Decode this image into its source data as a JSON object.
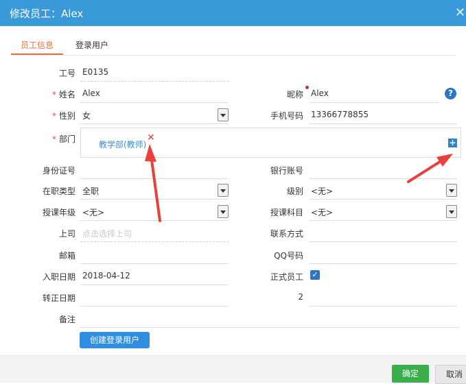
{
  "dialog": {
    "title": "修改员工：Alex"
  },
  "tabs": [
    {
      "label": "员工信息"
    },
    {
      "label": "登录用户"
    }
  ],
  "form": {
    "emp_no": {
      "label": "工号",
      "value": "E0135"
    },
    "name": {
      "label": "姓名",
      "value": "Alex"
    },
    "nickname": {
      "label": "昵称",
      "value": "Alex"
    },
    "gender": {
      "label": "性别",
      "value": "女"
    },
    "mobile": {
      "label": "手机号码",
      "value": "13366778855"
    },
    "dept": {
      "label": "部门",
      "tag": "教学部(教师)"
    },
    "idcard": {
      "label": "身份证号",
      "value": ""
    },
    "bank": {
      "label": "银行账号",
      "value": ""
    },
    "jobtype": {
      "label": "在职类型",
      "value": "全职"
    },
    "level": {
      "label": "级别",
      "value": "<无>"
    },
    "grade": {
      "label": "授课年级",
      "value": "<无>"
    },
    "subject": {
      "label": "授课科目",
      "value": "<无>"
    },
    "boss": {
      "label": "上司",
      "placeholder": "点击选择上司"
    },
    "contact": {
      "label": "联系方式",
      "value": ""
    },
    "email": {
      "label": "邮箱",
      "value": ""
    },
    "qq": {
      "label": "QQ号码",
      "value": ""
    },
    "hire_date": {
      "label": "入职日期",
      "value": "2018-04-12"
    },
    "formal": {
      "label": "正式员工",
      "checked": true
    },
    "regular_date": {
      "label": "转正日期",
      "value": ""
    },
    "two": {
      "label": "2",
      "value": ""
    },
    "remark": {
      "label": "备注",
      "value": ""
    }
  },
  "buttons": {
    "create_login": "创建登录用户",
    "ok": "确定",
    "cancel": "取消"
  },
  "colors": {
    "header": "#3a9ad9",
    "active_tab": "#e2723d",
    "ok": "#3aae4b",
    "arrow": "#e8403a"
  }
}
